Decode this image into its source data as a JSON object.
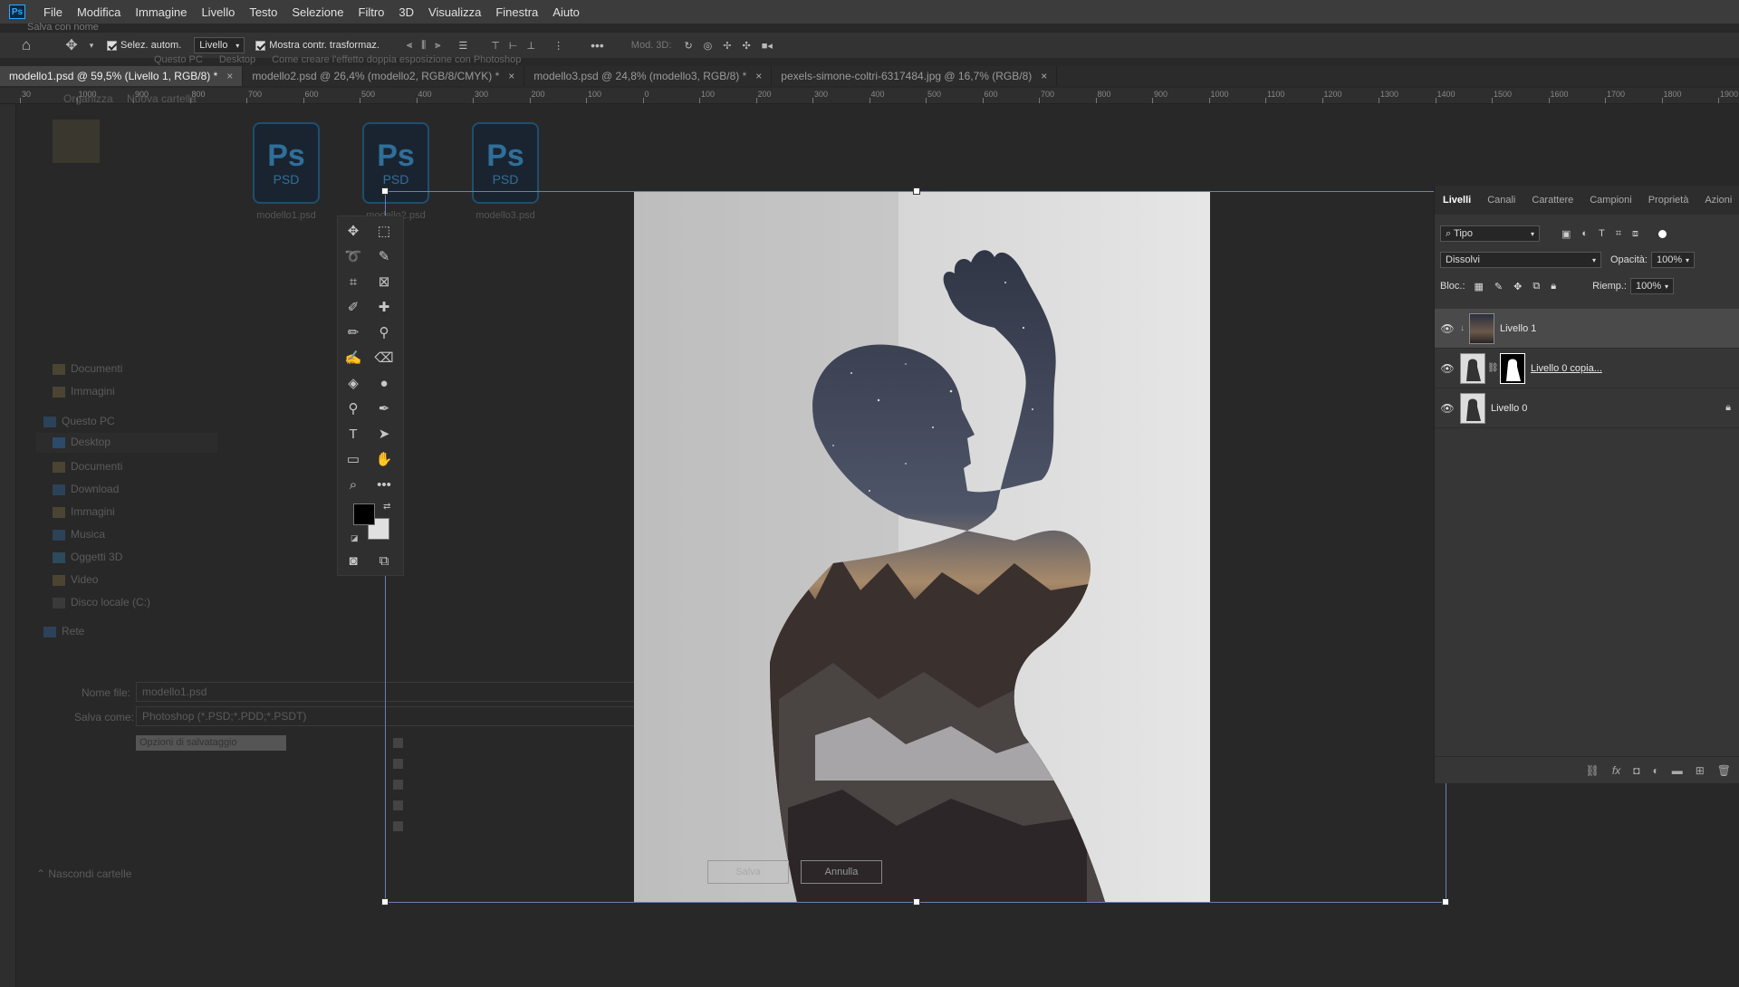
{
  "app": {
    "logo_text": "Ps",
    "menu": [
      "File",
      "Modifica",
      "Immagine",
      "Livello",
      "Testo",
      "Selezione",
      "Filtro",
      "3D",
      "Visualizza",
      "Finestra",
      "Aiuto"
    ]
  },
  "ghost_dialog": {
    "title": "Salva con nome",
    "breadcrumb": [
      "Questo PC",
      "Desktop",
      "Come creare l'effetto doppia esposizione con Photoshop"
    ],
    "organize": "Organizza",
    "new_folder": "Nuova cartella",
    "sidebar": [
      "Documenti",
      "Immagini",
      "Questo PC",
      "Desktop",
      "Documenti",
      "Download",
      "Immagini",
      "Musica",
      "Oggetti 3D",
      "Video",
      "Disco locale (C:)",
      "Rete"
    ],
    "files": [
      {
        "icon_text": "Ps",
        "ext": "PSD",
        "name": "modello1.psd"
      },
      {
        "icon_text": "Ps",
        "ext": "PSD",
        "name": "modello2.psd"
      },
      {
        "icon_text": "Ps",
        "ext": "PSD",
        "name": "modello3.psd"
      }
    ],
    "filename_label": "Nome file:",
    "filename_value": "modello1.psd",
    "saveas_label": "Salva come:",
    "saveas_value": "Photoshop (*.PSD;*.PDD;*.PSDT)",
    "options_label": "Opzioni di salvataggio",
    "hide_folders": "Nascondi cartelle",
    "save_button": "Salva",
    "cancel_button": "Annulla"
  },
  "options_bar": {
    "auto_select_label": "Selez. autom.",
    "auto_select_target": "Livello",
    "show_transform_label": "Mostra contr. trasformaz.",
    "mode_3d_label": "Mod. 3D:"
  },
  "tabs": [
    {
      "label": "modello1.psd @ 59,5% (Livello 1, RGB/8) *",
      "active": true
    },
    {
      "label": "modello2.psd @ 26,4% (modello2, RGB/8/CMYK) *",
      "active": false
    },
    {
      "label": "modello3.psd @ 24,8% (modello3, RGB/8) *",
      "active": false
    },
    {
      "label": "pexels-simone-coltri-6317484.jpg @ 16,7% (RGB/8)",
      "active": false
    }
  ],
  "ruler": {
    "labels": [
      "30",
      "1000",
      "900",
      "800",
      "700",
      "600",
      "500",
      "400",
      "300",
      "200",
      "100",
      "0",
      "100",
      "200",
      "300",
      "400",
      "500",
      "600",
      "700",
      "800",
      "900",
      "1000",
      "1100",
      "1200",
      "1300",
      "1400",
      "1500",
      "1600",
      "1700",
      "1800",
      "1900"
    ]
  },
  "layers_panel": {
    "tabs": [
      "Livelli",
      "Canali",
      "Carattere",
      "Campioni",
      "Proprietà",
      "Azioni"
    ],
    "filter_label": "Tipo",
    "blend_mode": "Dissolvi",
    "opacity_label": "Opacità:",
    "opacity_value": "100%",
    "lock_label": "Bloc.:",
    "fill_label": "Riemp.:",
    "fill_value": "100%",
    "layers": [
      {
        "name": "Livello 1",
        "selected": true,
        "clipped": true
      },
      {
        "name": "Livello 0 copia...",
        "selected": false,
        "mask": true
      },
      {
        "name": "Livello 0",
        "selected": false,
        "locked": true
      }
    ]
  },
  "colors": {
    "accent": "#31a8ff",
    "selection_border": "#6a7fb8",
    "panel_bg": "#363636"
  }
}
